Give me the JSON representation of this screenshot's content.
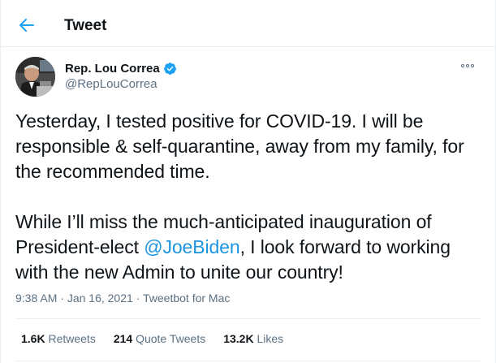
{
  "header": {
    "title": "Tweet",
    "back_icon": "arrow-left-icon"
  },
  "author": {
    "name": "Rep. Lou Correa",
    "handle": "@RepLouCorrea",
    "verified": true,
    "verified_color": "#1da1f2"
  },
  "tweet": {
    "paragraph1_lines": [
      "Yesterday, I tested positive for COVID-19. I will be",
      "responsible & self-quarantine, away from my family, for",
      "the recommended time."
    ],
    "paragraph2_line1": "While I’ll miss the much-anticipated inauguration of",
    "paragraph2_line2_before": "President-elect ",
    "mention": "@JoeBiden",
    "paragraph2_line2_after": ", I look forward to working",
    "paragraph2_line3": "with the new Admin to unite our country!"
  },
  "meta": {
    "time": "9:38 AM",
    "separator": " · ",
    "date": "Jan 16, 2021",
    "source": "Tweetbot for Mac"
  },
  "stats": {
    "retweets_count": "1.6K",
    "retweets_label": " Retweets",
    "quotes_count": "214",
    "quotes_label": " Quote Tweets",
    "likes_count": "13.2K",
    "likes_label": " Likes"
  },
  "colors": {
    "accent": "#1da1f2",
    "link": "#1b95e0",
    "secondary_text": "#5b7083"
  }
}
